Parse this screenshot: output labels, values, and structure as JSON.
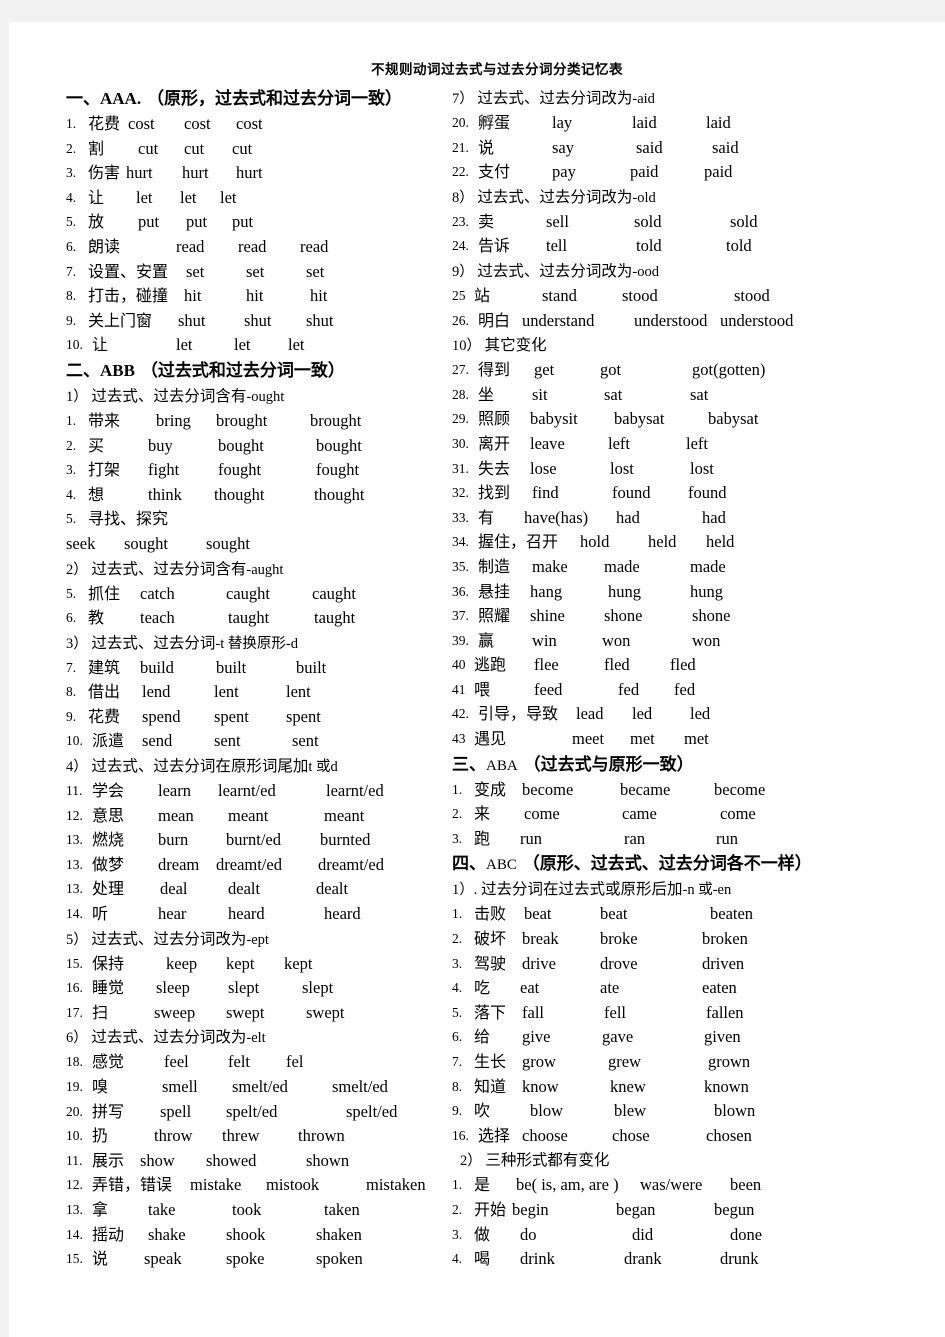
{
  "title": "不规则动词过去式与过去分词分类记忆表",
  "left_column": [
    {
      "kind": "h1",
      "idx": "一、",
      "lat": "AAA.",
      "cn": "（原形，过去式和过去分词一致）"
    },
    {
      "kind": "row",
      "num": "1.",
      "cn": "花费",
      "forms": [
        "cost",
        "cost",
        "cost"
      ],
      "offsets": [
        62,
        118,
        170
      ]
    },
    {
      "kind": "row",
      "num": "2.",
      "cn": "割",
      "forms": [
        "cut",
        "cut",
        "cut"
      ],
      "offsets": [
        72,
        118,
        166
      ]
    },
    {
      "kind": "row",
      "num": "3.",
      "cn": "伤害",
      "forms": [
        "hurt",
        "hurt",
        "hurt"
      ],
      "offsets": [
        60,
        116,
        170
      ]
    },
    {
      "kind": "row",
      "num": "4.",
      "cn": "让",
      "forms": [
        "let",
        "let",
        "let"
      ],
      "offsets": [
        70,
        114,
        154
      ]
    },
    {
      "kind": "row",
      "num": "5.",
      "cn": "放",
      "forms": [
        "put",
        "put",
        "put"
      ],
      "offsets": [
        72,
        120,
        166
      ]
    },
    {
      "kind": "row",
      "num": "6.",
      "cn": "朗读",
      "forms": [
        "read",
        "read",
        "read"
      ],
      "offsets": [
        110,
        172,
        234
      ]
    },
    {
      "kind": "row",
      "num": "7.",
      "cn": "设置、安置",
      "forms": [
        "set",
        "set",
        "set"
      ],
      "offsets": [
        120,
        180,
        240
      ]
    },
    {
      "kind": "row",
      "num": "8.",
      "cn": "打击，碰撞",
      "forms": [
        "hit",
        "hit",
        "hit"
      ],
      "offsets": [
        118,
        180,
        244
      ]
    },
    {
      "kind": "row",
      "num": "9.",
      "cn": "关上门窗",
      "forms": [
        "shut",
        "shut",
        "shut"
      ],
      "offsets": [
        112,
        178,
        240
      ]
    },
    {
      "kind": "row",
      "num": "10.",
      "cn": "让",
      "forms": [
        "let",
        "let",
        "let"
      ],
      "offsets": [
        110,
        168,
        222
      ]
    },
    {
      "kind": "h1",
      "idx": "二、",
      "lat": "ABB",
      "cn": "（过去式和过去分词一致）"
    },
    {
      "kind": "h2",
      "idx": "1）",
      "cn": "过去式、过去分词含有",
      "lat": "-ought"
    },
    {
      "kind": "row",
      "num": "1.",
      "cn": "带来",
      "forms": [
        "bring",
        "brought",
        "brought"
      ],
      "offsets": [
        90,
        150,
        244
      ]
    },
    {
      "kind": "row",
      "num": "2.",
      "cn": "买",
      "forms": [
        "buy",
        "bought",
        "bought"
      ],
      "offsets": [
        82,
        152,
        250
      ]
    },
    {
      "kind": "row",
      "num": "3.",
      "cn": "打架",
      "forms": [
        "fight",
        "fought",
        "fought"
      ],
      "offsets": [
        82,
        152,
        250
      ]
    },
    {
      "kind": "row",
      "num": "4.",
      "cn": "想",
      "forms": [
        "think",
        "thought",
        "thought"
      ],
      "offsets": [
        82,
        148,
        248
      ]
    },
    {
      "kind": "row",
      "num": "5.",
      "cn": "寻找、探究",
      "forms": [
        "",
        "",
        ""
      ],
      "offsets": [
        0,
        0,
        0
      ]
    },
    {
      "kind": "row",
      "num": "",
      "cn": "",
      "forms": [
        "seek",
        "sought",
        "sought"
      ],
      "offsets": [
        0,
        58,
        140
      ]
    },
    {
      "kind": "h2",
      "idx": "2）",
      "cn": "过去式、过去分词含有",
      "lat": "-aught"
    },
    {
      "kind": "row",
      "num": "5.",
      "cn": "抓住",
      "forms": [
        "catch",
        "caught",
        "caught"
      ],
      "offsets": [
        74,
        160,
        246
      ]
    },
    {
      "kind": "row",
      "num": "6.",
      "cn": "教",
      "forms": [
        "teach",
        "taught",
        "taught"
      ],
      "offsets": [
        74,
        162,
        248
      ]
    },
    {
      "kind": "h2",
      "idx": "3）",
      "cn": "过去式、过去分词",
      "lat": "-t 替换原形-d"
    },
    {
      "kind": "row",
      "num": "7.",
      "cn": "建筑",
      "forms": [
        "build",
        "built",
        "built"
      ],
      "offsets": [
        74,
        150,
        230
      ]
    },
    {
      "kind": "row",
      "num": "8.",
      "cn": "借出",
      "forms": [
        "lend",
        "lent",
        "lent"
      ],
      "offsets": [
        76,
        148,
        220
      ]
    },
    {
      "kind": "row",
      "num": "9.",
      "cn": "花费",
      "forms": [
        "spend",
        "spent",
        "spent"
      ],
      "offsets": [
        76,
        148,
        220
      ]
    },
    {
      "kind": "row",
      "num": "10.",
      "cn": "派遣",
      "forms": [
        "send",
        "sent",
        "sent"
      ],
      "offsets": [
        76,
        148,
        226
      ]
    },
    {
      "kind": "h2",
      "idx": "4）",
      "cn": "过去式、过去分词在原形词尾加",
      "lat": "t 或d"
    },
    {
      "kind": "row",
      "num": "11.",
      "cn": "学会",
      "forms": [
        "learn",
        "learnt/ed",
        "learnt/ed"
      ],
      "offsets": [
        92,
        152,
        260
      ]
    },
    {
      "kind": "row",
      "num": "12.",
      "cn": "意思",
      "forms": [
        "mean",
        "meant",
        "meant"
      ],
      "offsets": [
        92,
        162,
        258
      ]
    },
    {
      "kind": "row",
      "num": "13.",
      "cn": "燃烧",
      "forms": [
        "burn",
        "burnt/ed",
        "burnted"
      ],
      "offsets": [
        92,
        160,
        254
      ]
    },
    {
      "kind": "row",
      "num": "13.",
      "cn": "做梦",
      "forms": [
        "dream",
        "dreamt/ed",
        "dreamt/ed"
      ],
      "offsets": [
        92,
        150,
        252
      ]
    },
    {
      "kind": "row",
      "num": "13.",
      "cn": "处理",
      "forms": [
        "deal",
        "dealt",
        "dealt"
      ],
      "offsets": [
        94,
        162,
        250
      ]
    },
    {
      "kind": "row",
      "num": "14.",
      "cn": "听",
      "forms": [
        "hear",
        "heard",
        "heard"
      ],
      "offsets": [
        92,
        162,
        258
      ]
    },
    {
      "kind": "h2",
      "idx": "5）",
      "cn": "过去式、过去分词改为",
      "lat": "-ept"
    },
    {
      "kind": "row",
      "num": "15.",
      "cn": "保持",
      "forms": [
        "keep",
        "kept",
        "kept"
      ],
      "offsets": [
        100,
        160,
        218
      ]
    },
    {
      "kind": "row",
      "num": "16.",
      "cn": "睡觉",
      "forms": [
        "sleep",
        "slept",
        "slept"
      ],
      "offsets": [
        90,
        162,
        236
      ]
    },
    {
      "kind": "row",
      "num": "17.",
      "cn": "扫",
      "forms": [
        "sweep",
        "swept",
        "swept"
      ],
      "offsets": [
        88,
        160,
        240
      ]
    },
    {
      "kind": "h2",
      "idx": "6）",
      "cn": "过去式、过去分词改为",
      "lat": "-elt"
    },
    {
      "kind": "row",
      "num": "18.",
      "cn": "感觉",
      "forms": [
        "feel",
        "felt",
        "fel"
      ],
      "offsets": [
        98,
        162,
        220
      ]
    },
    {
      "kind": "row",
      "num": "19.",
      "cn": "嗅",
      "forms": [
        "smell",
        "smelt/ed",
        "smelt/ed"
      ],
      "offsets": [
        96,
        166,
        266
      ]
    },
    {
      "kind": "row",
      "num": "20.",
      "cn": "拼写",
      "forms": [
        "spell",
        "spelt/ed",
        "spelt/ed"
      ],
      "offsets": [
        94,
        160,
        280
      ]
    },
    {
      "kind": "row",
      "num": "10.",
      "cn": "扔",
      "forms": [
        "throw",
        "threw",
        "thrown"
      ],
      "offsets": [
        88,
        156,
        232
      ]
    },
    {
      "kind": "row",
      "num": "11.",
      "cn": "展示",
      "forms": [
        "show",
        "showed",
        "shown"
      ],
      "offsets": [
        74,
        140,
        240
      ]
    },
    {
      "kind": "row",
      "num": "12.",
      "cn": "弄错，错误",
      "forms": [
        "mistake",
        "mistook",
        "mistaken"
      ],
      "offsets": [
        124,
        200,
        300
      ]
    },
    {
      "kind": "row",
      "num": "13.",
      "cn": "拿",
      "forms": [
        "take",
        "took",
        "taken"
      ],
      "offsets": [
        82,
        166,
        258
      ]
    },
    {
      "kind": "row",
      "num": "14.",
      "cn": "摇动",
      "forms": [
        "shake",
        "shook",
        "shaken"
      ],
      "offsets": [
        82,
        160,
        250
      ]
    },
    {
      "kind": "row",
      "num": "15.",
      "cn": "说",
      "forms": [
        "speak",
        "spoke",
        "spoken"
      ],
      "offsets": [
        78,
        160,
        250
      ]
    }
  ],
  "right_column": [
    {
      "kind": "h2",
      "idx": "7）",
      "cn": "过去式、过去分词改为",
      "lat": "-aid"
    },
    {
      "kind": "row",
      "num": "20.",
      "cn": "孵蛋",
      "forms": [
        "lay",
        "laid",
        "laid"
      ],
      "offsets": [
        100,
        180,
        254
      ]
    },
    {
      "kind": "row",
      "num": "21.",
      "cn": "说",
      "forms": [
        "say",
        "said",
        "said"
      ],
      "offsets": [
        100,
        184,
        260
      ]
    },
    {
      "kind": "row",
      "num": "22.",
      "cn": "支付",
      "forms": [
        "pay",
        "paid",
        "paid"
      ],
      "offsets": [
        100,
        178,
        252
      ]
    },
    {
      "kind": "h2",
      "idx": "8）",
      "cn": "过去式、过去分词改为",
      "lat": "-old"
    },
    {
      "kind": "row",
      "num": "23.",
      "cn": "卖",
      "forms": [
        "sell",
        "sold",
        "sold"
      ],
      "offsets": [
        94,
        182,
        278
      ]
    },
    {
      "kind": "row",
      "num": "24.",
      "cn": "告诉",
      "forms": [
        "tell",
        "told",
        "told"
      ],
      "offsets": [
        94,
        184,
        274
      ]
    },
    {
      "kind": "h2",
      "idx": "9）",
      "cn": "过去式、过去分词改为",
      "lat": "-ood"
    },
    {
      "kind": "row",
      "num": "25",
      "cn": "站",
      "forms": [
        "stand",
        "stood",
        "stood"
      ],
      "offsets": [
        90,
        170,
        282
      ]
    },
    {
      "kind": "row",
      "num": "26.",
      "cn": "明白",
      "forms": [
        "understand",
        "understood",
        "understood"
      ],
      "offsets": [
        70,
        182,
        268
      ]
    },
    {
      "kind": "h2",
      "idx": "10）",
      "cn": "其它变化",
      "lat": ""
    },
    {
      "kind": "row",
      "num": "27.",
      "cn": "得到",
      "forms": [
        "get",
        "got",
        "got(gotten)"
      ],
      "offsets": [
        82,
        148,
        240
      ]
    },
    {
      "kind": "row",
      "num": "28.",
      "cn": "坐",
      "forms": [
        "sit",
        "sat",
        "sat"
      ],
      "offsets": [
        80,
        152,
        238
      ]
    },
    {
      "kind": "row",
      "num": "29.",
      "cn": "照顾",
      "forms": [
        "babysit",
        "babysat",
        "babysat"
      ],
      "offsets": [
        78,
        162,
        256
      ]
    },
    {
      "kind": "row",
      "num": "30.",
      "cn": "离开",
      "forms": [
        "leave",
        "left",
        "left"
      ],
      "offsets": [
        78,
        156,
        234
      ]
    },
    {
      "kind": "row",
      "num": "31.",
      "cn": "失去",
      "forms": [
        "lose",
        "lost",
        "lost"
      ],
      "offsets": [
        78,
        158,
        238
      ]
    },
    {
      "kind": "row",
      "num": "32.",
      "cn": "找到",
      "forms": [
        "find",
        "found",
        "found"
      ],
      "offsets": [
        80,
        160,
        236
      ]
    },
    {
      "kind": "row",
      "num": "33.",
      "cn": "有",
      "forms": [
        "have(has)",
        "had",
        "had"
      ],
      "offsets": [
        72,
        164,
        250
      ]
    },
    {
      "kind": "row",
      "num": "34.",
      "cn": "握住，召开",
      "forms": [
        "hold",
        "held",
        "held"
      ],
      "offsets": [
        128,
        196,
        254
      ]
    },
    {
      "kind": "row",
      "num": "35.",
      "cn": "制造",
      "forms": [
        "make",
        "made",
        "made"
      ],
      "offsets": [
        80,
        152,
        238
      ]
    },
    {
      "kind": "row",
      "num": "36.",
      "cn": "悬挂",
      "forms": [
        "hang",
        "hung",
        "hung"
      ],
      "offsets": [
        78,
        156,
        238
      ]
    },
    {
      "kind": "row",
      "num": "37.",
      "cn": "照耀",
      "forms": [
        "shine",
        "shone",
        "shone"
      ],
      "offsets": [
        78,
        152,
        240
      ]
    },
    {
      "kind": "row",
      "num": "39.",
      "cn": "赢",
      "forms": [
        "win",
        "won",
        "won"
      ],
      "offsets": [
        80,
        150,
        240
      ]
    },
    {
      "kind": "row",
      "num": "40",
      "cn": "逃跑",
      "forms": [
        "flee",
        "fled",
        "fled"
      ],
      "offsets": [
        82,
        152,
        218
      ]
    },
    {
      "kind": "row",
      "num": "41",
      "cn": "喂",
      "forms": [
        "feed",
        "fed",
        "fed"
      ],
      "offsets": [
        82,
        166,
        222
      ]
    },
    {
      "kind": "row",
      "num": "42.",
      "cn": "引导，导致",
      "forms": [
        "lead",
        "led",
        "led"
      ],
      "offsets": [
        124,
        180,
        238
      ]
    },
    {
      "kind": "row",
      "num": "43",
      "cn": "遇见",
      "forms": [
        "meet",
        "met",
        "met"
      ],
      "offsets": [
        120,
        178,
        232
      ]
    },
    {
      "kind": "h1",
      "idx": "三、",
      "lat": "ABA",
      "cn": "（过去式与原形一致）",
      "thin": true
    },
    {
      "kind": "row",
      "num": "1.",
      "cn": "变成",
      "forms": [
        "become",
        "became",
        "become"
      ],
      "offsets": [
        70,
        168,
        262
      ]
    },
    {
      "kind": "row",
      "num": "2.",
      "cn": "来",
      "forms": [
        "come",
        "came",
        "come"
      ],
      "offsets": [
        72,
        170,
        268
      ]
    },
    {
      "kind": "row",
      "num": "3.",
      "cn": "跑",
      "forms": [
        "run",
        "ran",
        "run"
      ],
      "offsets": [
        68,
        172,
        264
      ]
    },
    {
      "kind": "h1",
      "idx": "四、",
      "lat": "ABC",
      "cn": "（原形、过去式、过去分词各不一样）",
      "thin": true
    },
    {
      "kind": "h2",
      "idx": "1）.",
      "cn": "过去分词在过去式或原形后加",
      "lat": "-n 或-en"
    },
    {
      "kind": "row",
      "num": "1.",
      "cn": "击败",
      "forms": [
        "beat",
        "beat",
        "beaten"
      ],
      "offsets": [
        72,
        148,
        258
      ]
    },
    {
      "kind": "row",
      "num": "2.",
      "cn": "破坏",
      "forms": [
        "break",
        "broke",
        "broken"
      ],
      "offsets": [
        70,
        148,
        250
      ]
    },
    {
      "kind": "row",
      "num": "3.",
      "cn": "驾驶",
      "forms": [
        "drive",
        "drove",
        "driven"
      ],
      "offsets": [
        70,
        148,
        250
      ]
    },
    {
      "kind": "row",
      "num": "4.",
      "cn": "吃",
      "forms": [
        "eat",
        "ate",
        "eaten"
      ],
      "offsets": [
        68,
        148,
        250
      ]
    },
    {
      "kind": "row",
      "num": "5.",
      "cn": "落下",
      "forms": [
        "fall",
        "fell",
        "fallen"
      ],
      "offsets": [
        70,
        152,
        254
      ]
    },
    {
      "kind": "row",
      "num": "6.",
      "cn": "给",
      "forms": [
        "give",
        "gave",
        "given"
      ],
      "offsets": [
        70,
        150,
        252
      ]
    },
    {
      "kind": "row",
      "num": "7.",
      "cn": "生长",
      "forms": [
        "grow",
        "grew",
        "grown"
      ],
      "offsets": [
        70,
        156,
        256
      ]
    },
    {
      "kind": "row",
      "num": "8.",
      "cn": "知道",
      "forms": [
        "know",
        "knew",
        "known"
      ],
      "offsets": [
        70,
        158,
        252
      ]
    },
    {
      "kind": "row",
      "num": "9.",
      "cn": "吹",
      "forms": [
        "blow",
        "blew",
        "blown"
      ],
      "offsets": [
        78,
        162,
        262
      ]
    },
    {
      "kind": "row",
      "num": "16.",
      "cn": "选择",
      "forms": [
        "choose",
        "chose",
        "chosen"
      ],
      "offsets": [
        70,
        160,
        254
      ]
    },
    {
      "kind": "h2",
      "idx": "2）",
      "cn": "三种形式都有变化",
      "lat": "",
      "indent": 8
    },
    {
      "kind": "row",
      "num": "1.",
      "cn": "是",
      "forms": [
        "be( is, am, are )",
        "was/were",
        "been"
      ],
      "offsets": [
        64,
        188,
        278
      ]
    },
    {
      "kind": "row",
      "num": "2.",
      "cn": "开始",
      "forms": [
        "begin",
        "began",
        "begun"
      ],
      "offsets": [
        60,
        164,
        262
      ]
    },
    {
      "kind": "row",
      "num": "3.",
      "cn": "做",
      "forms": [
        "do",
        "did",
        "done"
      ],
      "offsets": [
        68,
        180,
        278
      ]
    },
    {
      "kind": "row",
      "num": "4.",
      "cn": "喝",
      "forms": [
        "drink",
        "drank",
        "drunk"
      ],
      "offsets": [
        68,
        172,
        268
      ]
    }
  ]
}
